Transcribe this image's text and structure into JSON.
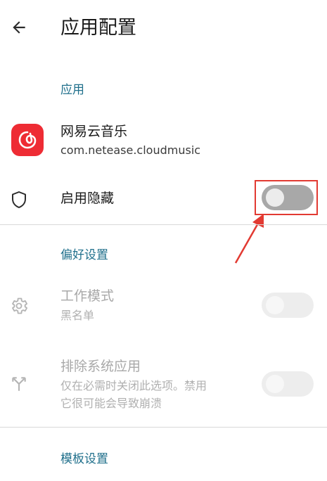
{
  "header": {
    "title": "应用配置",
    "back_icon": "arrow-left-icon"
  },
  "sections": {
    "app": "应用",
    "preferences": "偏好设置",
    "templates": "模板设置"
  },
  "app_item": {
    "name": "网易云音乐",
    "package": "com.netease.cloudmusic",
    "icon": "netease-cloud-music-icon",
    "icon_color": "#ee2c34"
  },
  "enable_hide": {
    "label": "启用隐藏",
    "icon": "shield-icon",
    "toggle_on": false
  },
  "work_mode": {
    "label": "工作模式",
    "value": "黑名单",
    "icon": "gear-icon",
    "toggle_on": false
  },
  "exclude_system": {
    "label": "排除系统应用",
    "description_line1": "仅在必需时关闭此选项。禁用",
    "description_line2": "它很可能会导致崩溃",
    "icon": "merge-arrows-icon",
    "toggle_on": false
  },
  "colors": {
    "accent": "#1f6f8b",
    "annotation": "#e23a32"
  }
}
